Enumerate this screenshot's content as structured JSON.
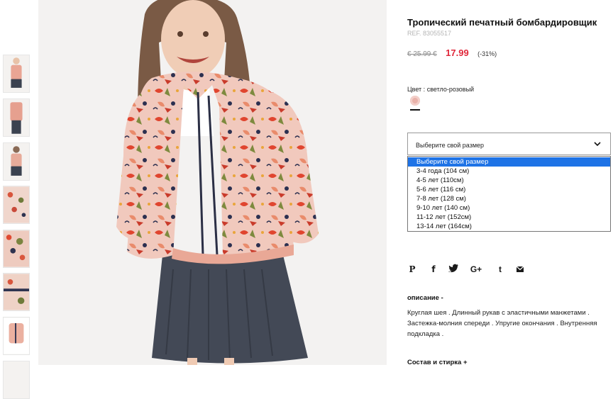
{
  "product": {
    "title": "Тропический печатный бомбардировщик",
    "ref": "REF. 83055517",
    "old_price": "€ 25.99 €",
    "new_price": "17.99",
    "discount": "(-31%)"
  },
  "color": {
    "label": "Цвет :",
    "value": "светло-розовый",
    "swatch_hex": "#e9b2aa"
  },
  "size": {
    "selected_label": "Выберите свой размер",
    "options": [
      "Выберите свой размер",
      "3-4 года (104 см)",
      "4-5 лет (110см)",
      "5-6 лет (116 см)",
      "7-8 лет (128 см)",
      "9-10 лет (140 см)",
      "11-12 лет (152см)",
      "13-14 лет (164см)"
    ]
  },
  "share": {
    "pinterest": "P",
    "facebook": "f",
    "twitter": "t",
    "googleplus": "G+",
    "tumblr": "t"
  },
  "description": {
    "heading": "описание -",
    "text": "Круглая шея . Длинный рукав с эластичными манжетами . Застежка-молния спереди . Упругие окончания . Внутренняя подкладка ."
  },
  "composition": {
    "heading": "Состав и стирка +"
  },
  "colors": {
    "accent_price": "#e0273a",
    "selected_option": "#1e73e6"
  }
}
